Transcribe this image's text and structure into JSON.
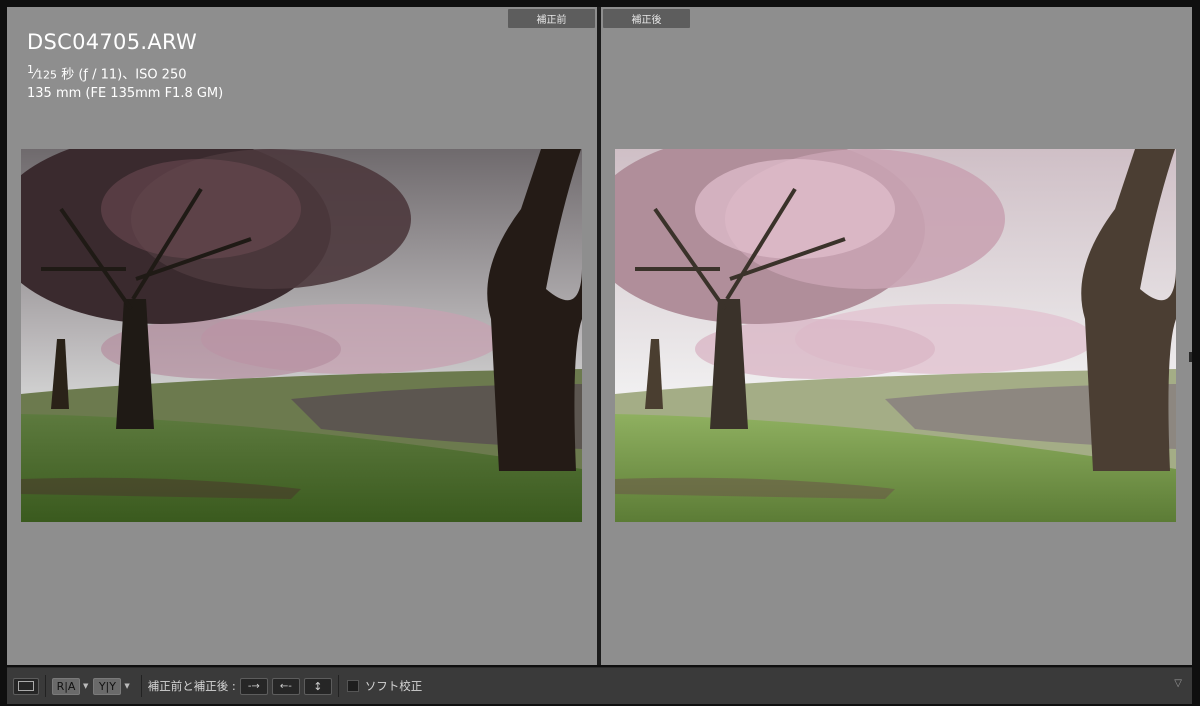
{
  "left_panel": {
    "tag": "補正前",
    "file": {
      "name": "DSC04705.ARW",
      "shutter_num": "1",
      "shutter_den": "125",
      "shutter_rest": " 秒 (ƒ / 11)、ISO 250",
      "lens_line": "135 mm (FE 135mm F1.8 GM)"
    }
  },
  "right_panel": {
    "tag": "補正後"
  },
  "toolbar": {
    "loupe_icon": "single-view-icon",
    "ra_label": "R|A",
    "yy_label": "Y|Y",
    "copy_label": "補正前と補正後 :",
    "swap_label": "ソフト校正"
  },
  "colors": {
    "panel_bg": "#8e8e8e",
    "toolbar_bg": "#3a3a3a",
    "tag_bg": "#5d5d5d"
  }
}
